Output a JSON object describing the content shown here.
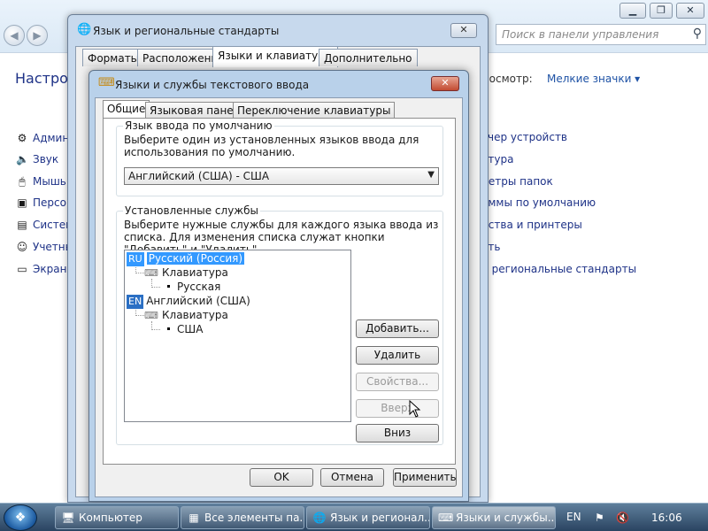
{
  "control_panel": {
    "search_placeholder": "Поиск в панели управления",
    "heading": "Настрой",
    "view_label": "Просмотр:",
    "view_value": "Мелкие значки ▾",
    "left_items": [
      {
        "label": "Админ",
        "icon": "admin-tools-icon"
      },
      {
        "label": "Звук",
        "icon": "sound-icon"
      },
      {
        "label": "Мышь",
        "icon": "mouse-icon"
      },
      {
        "label": "Персон",
        "icon": "personalization-icon"
      },
      {
        "label": "Систем",
        "icon": "system-icon"
      },
      {
        "label": "Учетны",
        "icon": "user-accounts-icon"
      },
      {
        "label": "Экран",
        "icon": "display-icon"
      }
    ],
    "right_items": [
      "тчер устройств",
      "атура",
      "нетры папок",
      "аммы по умолчанию",
      "йства и принтеры",
      "ать",
      "и региональные стандарты"
    ]
  },
  "regional_window": {
    "title": "Язык и региональные стандарты",
    "tabs": [
      "Форматы",
      "Расположение",
      "Языки и клавиатуры",
      "Дополнительно"
    ],
    "active_tab": 2
  },
  "dialog": {
    "title": "Языки и службы текстового ввода",
    "tabs": [
      "Общие",
      "Языковая панель",
      "Переключение клавиатуры"
    ],
    "active_tab": 0,
    "default_language": {
      "group_title": "Язык ввода по умолчанию",
      "description": "Выберите один из установленных языков ввода для использования по умолчанию.",
      "selected": "Английский (США) - США"
    },
    "installed_services": {
      "group_title": "Установленные службы",
      "description": "Выберите нужные службы для каждого языка ввода из списка. Для изменения списка служат кнопки \"Добавить\" и \"Удалить\".",
      "tree": [
        {
          "code": "RU",
          "language": "Русский (Россия)",
          "category": "Клавиатура",
          "layout": "Русская",
          "selected": true
        },
        {
          "code": "EN",
          "language": "Английский (США)",
          "category": "Клавиатура",
          "layout": "США",
          "selected": false
        }
      ]
    },
    "side_buttons": {
      "add": "Добавить...",
      "remove": "Удалить",
      "properties": "Свойства...",
      "up": "Вверх",
      "down": "Вниз"
    },
    "footer_buttons": {
      "ok": "OK",
      "cancel": "Отмена",
      "apply": "Применить"
    }
  },
  "taskbar": {
    "buttons": [
      {
        "label": "Компьютер",
        "icon": "computer-icon"
      },
      {
        "label": "Все элементы па...",
        "icon": "control-panel-icon"
      },
      {
        "label": "Язык и регионал...",
        "icon": "globe-icon"
      },
      {
        "label": "Языки и службы...",
        "icon": "keyboard-icon"
      }
    ],
    "language": "EN",
    "clock": "16:06"
  }
}
